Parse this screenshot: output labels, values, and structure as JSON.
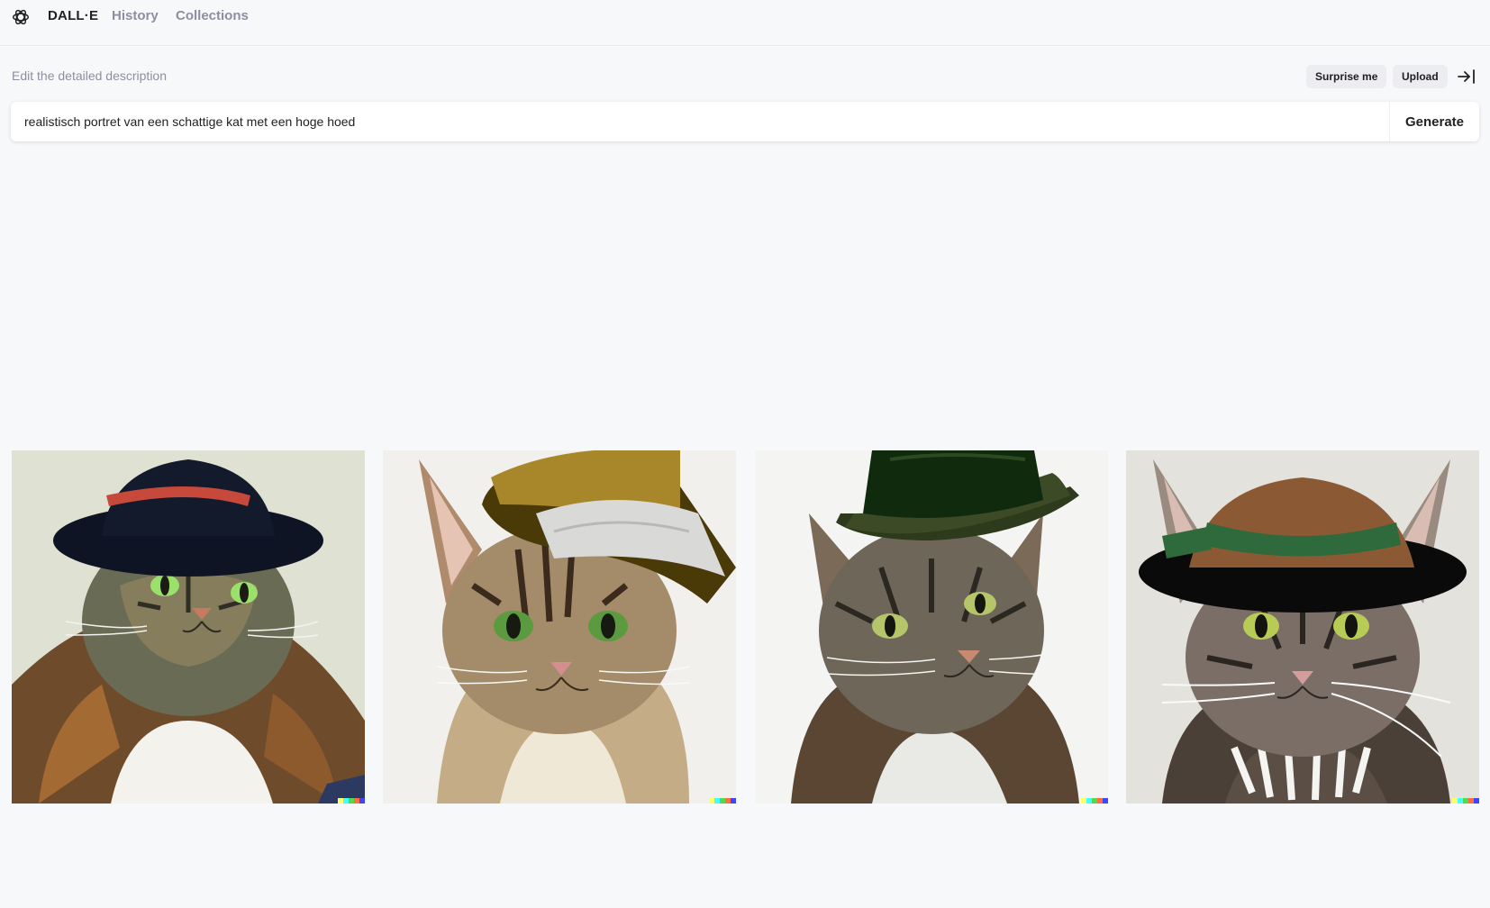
{
  "header": {
    "brand": "DALL·E",
    "nav": [
      "History",
      "Collections"
    ]
  },
  "editor": {
    "label": "Edit the detailed description",
    "surprise_label": "Surprise me",
    "upload_label": "Upload",
    "prompt_value": "realistisch portret van een schattige kat met een hoge hoed",
    "generate_label": "Generate"
  },
  "gallery": {
    "images": [
      {
        "subject": "fluffy tabby cat wearing black hat with red band"
      },
      {
        "subject": "striped kitten wearing gold and grey top hat"
      },
      {
        "subject": "grey tabby cat wearing dark green top hat"
      },
      {
        "subject": "tabby cat wearing brown and green wide-brim hat"
      }
    ],
    "signature_colors": [
      "#ffff66",
      "#42ffff",
      "#51da4c",
      "#ff6e3c",
      "#3c46ff"
    ]
  },
  "icons": [
    "openai-logo-icon",
    "collapse-panel-icon"
  ]
}
